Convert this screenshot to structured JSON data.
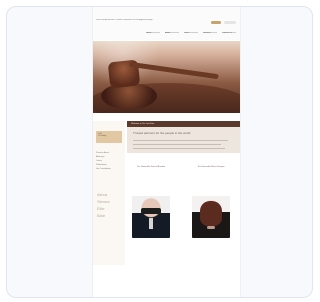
{
  "page": {
    "site_title": "Ross and Associates Trusted Counselors to the Appointed Eight",
    "nav": [
      "Home",
      "About",
      "Team",
      "Services",
      "Contact Us"
    ],
    "hero_alt": "gavel image",
    "sidebar": {
      "highlight": [
        "Call",
        "Us Today"
      ],
      "links": [
        "Practice Areas",
        "Attorneys",
        "Courts",
        "Publications",
        "Get Consultation"
      ],
      "contact_lines": [
        "Alexa",
        "Sienna",
        "Ellie",
        "Blair"
      ]
    },
    "intro": {
      "header": "Welcome to Our Law Firm",
      "title": "Trusted partners for the people in the world"
    },
    "profiles": [
      {
        "name": "The Honorable Samuel Bowden"
      },
      {
        "name": "The Honorable Elena Vasquez"
      }
    ]
  }
}
